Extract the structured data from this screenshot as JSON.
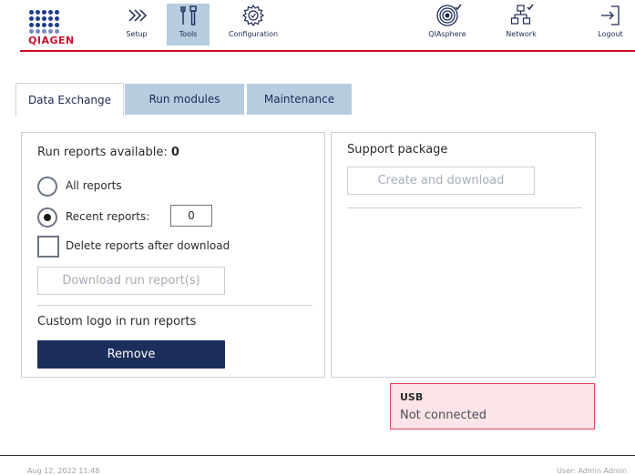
{
  "brand": {
    "logo_text": "QIAGEN",
    "accent_color": "#c9102e",
    "navy": "#1c2f5c"
  },
  "nav": {
    "setup": {
      "label": "Setup",
      "icon": "chevrons-right-icon"
    },
    "tools": {
      "label": "Tools",
      "icon": "tools-icon",
      "active": true
    },
    "configuration": {
      "label": "Configuration",
      "icon": "gear-icon"
    },
    "qiasphere": {
      "label": "QIAsphere",
      "icon": "qiasphere-icon",
      "status": "connected"
    },
    "network": {
      "label": "Network",
      "icon": "network-icon",
      "status": "connected"
    },
    "logout": {
      "label": "Logout",
      "icon": "logout-icon"
    }
  },
  "tabs": [
    {
      "label": "Data Exchange",
      "active": true
    },
    {
      "label": "Run modules",
      "active": false
    },
    {
      "label": "Maintenance",
      "active": false
    }
  ],
  "run_reports": {
    "title": "Run reports available:",
    "count": "0",
    "option_all": "All reports",
    "option_recent": "Recent reports:",
    "recent_value": "0",
    "selected_option": "recent",
    "delete_after_download": "Delete reports after download",
    "delete_checked": false,
    "download_button": "Download run report(s)"
  },
  "custom_logo": {
    "title": "Custom logo in run reports",
    "remove_button": "Remove"
  },
  "support_package": {
    "title": "Support package",
    "create_button": "Create and download"
  },
  "usb": {
    "title": "USB",
    "status": "Not connected"
  },
  "footer": {
    "datetime": "Aug 12, 2022 11:48",
    "user": "User: Admin Admin"
  }
}
